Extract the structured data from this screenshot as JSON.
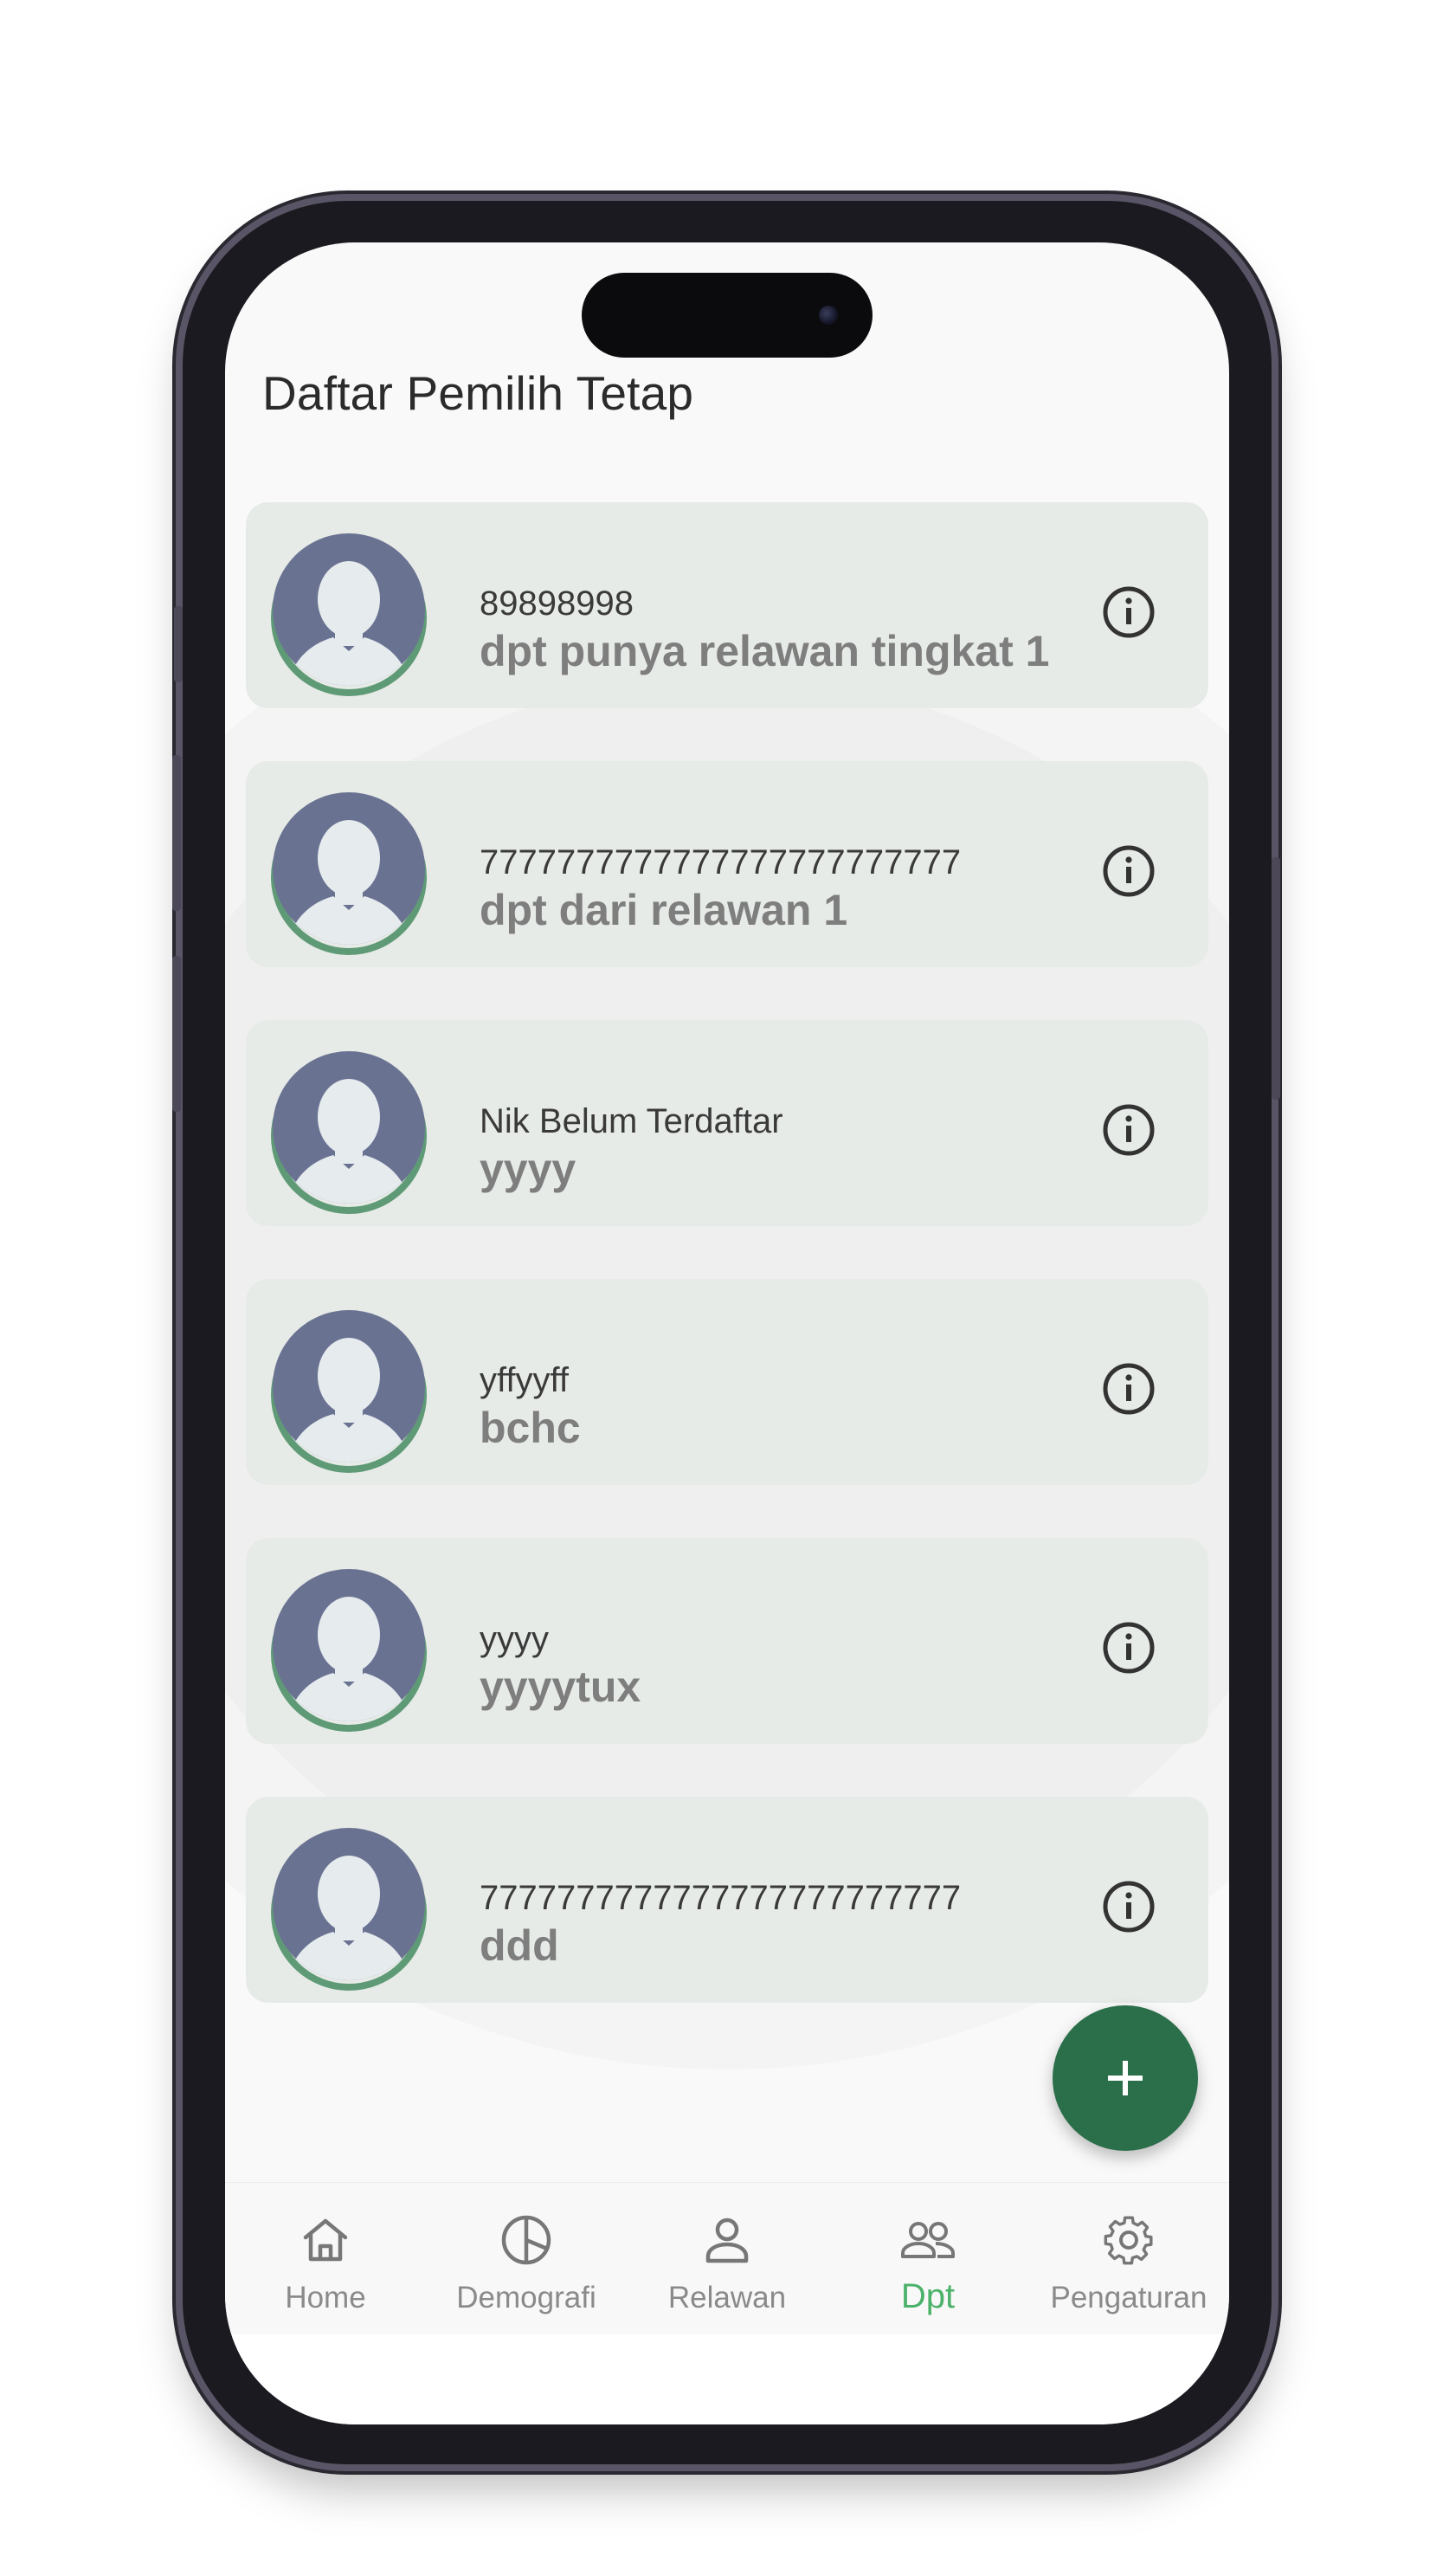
{
  "app": {
    "title": "Daftar Pemilih Tetap"
  },
  "voters": [
    {
      "nik": "89898998",
      "name": "dpt punya relawan tingkat 1"
    },
    {
      "nik": "7777777777777777777777777",
      "name": "dpt dari relawan 1"
    },
    {
      "nik": "Nik Belum Terdaftar",
      "name": "yyyy"
    },
    {
      "nik": "yffyyff",
      "name": "bchc"
    },
    {
      "nik": "yyyy",
      "name": "yyyytux"
    },
    {
      "nik": "7777777777777777777777777",
      "name": "ddd"
    }
  ],
  "fab": {
    "icon": "plus-icon",
    "label": "+"
  },
  "nav": [
    {
      "label": "Home",
      "icon": "home-icon",
      "active": false
    },
    {
      "label": "Demografi",
      "icon": "pie-chart-icon",
      "active": false
    },
    {
      "label": "Relawan",
      "icon": "person-icon",
      "active": false
    },
    {
      "label": "Dpt",
      "icon": "people-icon",
      "active": true
    },
    {
      "label": "Pengaturan",
      "icon": "gear-icon",
      "active": false
    }
  ],
  "colors": {
    "accent": "#2b6e4a",
    "nav_active": "#4cb26a",
    "card_bg": "#e7ebe7",
    "avatar_ring": "#5f9a76",
    "avatar_bg": "#6a7292"
  }
}
